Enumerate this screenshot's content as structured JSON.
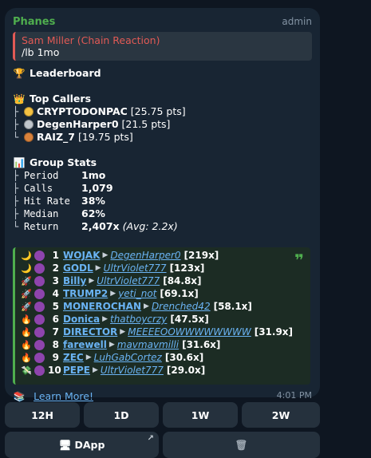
{
  "message": {
    "sender": "Phanes",
    "role": "admin",
    "reply": {
      "name": "Sam Miller (Chain Reaction)",
      "text": "/lb 1mo"
    },
    "leaderboard_title": "Leaderboard",
    "top_callers_title": "Top Callers",
    "top_callers": [
      {
        "name": "CRYPTODONPAC",
        "pts": "[25.75 pts]",
        "medal_color": "#f5c242"
      },
      {
        "name": "DegenHarper0",
        "pts": "[21.5 pts]",
        "medal_color": "#c0c6cc"
      },
      {
        "name": "RAIZ_7",
        "pts": "[19.75 pts]",
        "medal_color": "#d9823b"
      }
    ],
    "group_stats_title": "Group Stats",
    "stats": [
      {
        "key": "Period",
        "value": "1mo",
        "extra": ""
      },
      {
        "key": "Calls",
        "value": "1,079",
        "extra": ""
      },
      {
        "key": "Hit Rate",
        "value": "38%",
        "extra": ""
      },
      {
        "key": "Median",
        "value": "62%",
        "extra": ""
      },
      {
        "key": "Return",
        "value": "2,407x",
        "extra": "(Avg: 2.2x)"
      }
    ],
    "entries": [
      {
        "emoji": "moon-icon",
        "rank": "1",
        "ticker": "WOJAK",
        "caller": "DegenHarper0",
        "mult": "[219x]"
      },
      {
        "emoji": "moon-icon",
        "rank": "2",
        "ticker": "GODL",
        "caller": "UltrViolet777",
        "mult": "[123x]"
      },
      {
        "emoji": "rocket-icon",
        "rank": "3",
        "ticker": "Billy",
        "caller": "UltrViolet777",
        "mult": "[84.8x]"
      },
      {
        "emoji": "rocket-icon",
        "rank": "4",
        "ticker": "TRUMP2",
        "caller": "yeti_not",
        "mult": "[69.1x]"
      },
      {
        "emoji": "rocket-icon",
        "rank": "5",
        "ticker": "MONEROCHAN",
        "caller": "Drenched42",
        "mult": "[58.1x]"
      },
      {
        "emoji": "fire-icon",
        "rank": "6",
        "ticker": "Donica",
        "caller": "thatboycrzy",
        "mult": "[47.5x]"
      },
      {
        "emoji": "fire-icon",
        "rank": "7",
        "ticker": "DIRECTOR",
        "caller": "MEEEEOOWWWWWWWW",
        "mult": "[31.9x]"
      },
      {
        "emoji": "fire-icon",
        "rank": "8",
        "ticker": "farewell",
        "caller": "mavmavmilli",
        "mult": "[31.6x]"
      },
      {
        "emoji": "fire-icon",
        "rank": "9",
        "ticker": "ZEC",
        "caller": "LuhGabCortez",
        "mult": "[30.6x]"
      },
      {
        "emoji": "money-icon",
        "rank": "10",
        "ticker": "PEPE",
        "caller": "UltrViolet777",
        "mult": "[29.0x]"
      }
    ],
    "learn_more": "Learn More!",
    "time": "4:01 PM"
  },
  "buttons": {
    "b12h": "12H",
    "b1d": "1D",
    "b1w": "1W",
    "b2w": "2W",
    "dapp": "DApp"
  },
  "colors": {
    "accent_green": "#4fae4e",
    "link_blue": "#6ab3f3",
    "reply_red": "#e25a55",
    "coin_purple": "#8e44ad"
  }
}
